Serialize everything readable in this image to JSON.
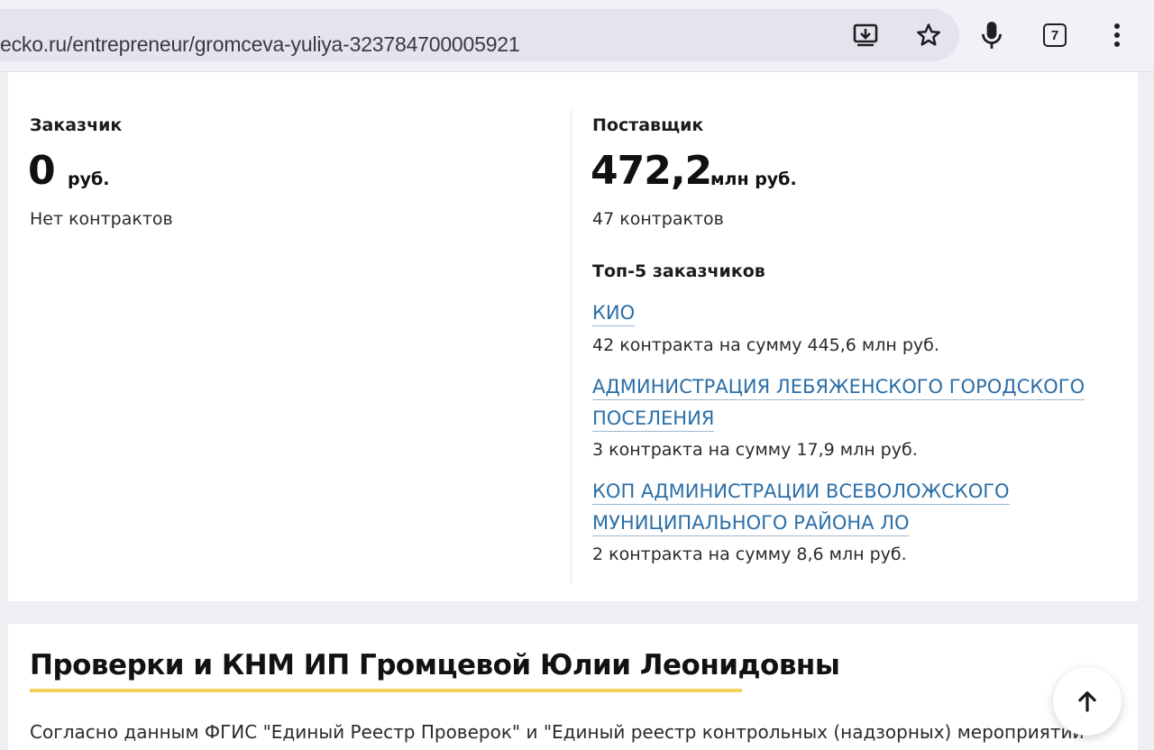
{
  "browser": {
    "url": "ecko.ru/entrepreneur/gromceva-yuliya-323784700005921",
    "tab_count": "7",
    "icons": [
      "download-icon",
      "star-icon",
      "mic-icon",
      "tabs-icon",
      "more-vert-icon"
    ]
  },
  "contracts": {
    "customer": {
      "label": "Заказчик",
      "amount": "0",
      "unit": "руб.",
      "summary": "Нет контрактов"
    },
    "supplier": {
      "label": "Поставщик",
      "amount": "472,2",
      "unit": "млн руб.",
      "summary": "47 контрактов",
      "top_title": "Топ-5 заказчиков",
      "top_customers": [
        {
          "name_lines": [
            "КИО"
          ],
          "detail": "42 контракта на сумму 445,6 млн руб."
        },
        {
          "name_lines": [
            "АДМИНИСТРАЦИЯ ЛЕБЯЖЕНСКОГО ГОРОДСКОГО",
            "ПОСЕЛЕНИЯ"
          ],
          "detail": "3 контракта на сумму 17,9 млн руб."
        },
        {
          "name_lines": [
            "КОП АДМИНИСТРАЦИИ ВСЕВОЛОЖСКОГО",
            "МУНИЦИПАЛЬНОГО РАЙОНА ЛО"
          ],
          "detail": "2 контракта на сумму 8,6 млн руб."
        }
      ]
    }
  },
  "inspections": {
    "title": "Проверки и КНМ ИП Громцевой Юлии Леонидовны",
    "intro": "Согласно данным ФГИС \"Единый Реестр Проверок\" и \"Единый реестр контрольных (надзорных) мероприятий\""
  },
  "colors": {
    "link": "#2b6fa8",
    "accent_underline": "#f2d25a"
  }
}
